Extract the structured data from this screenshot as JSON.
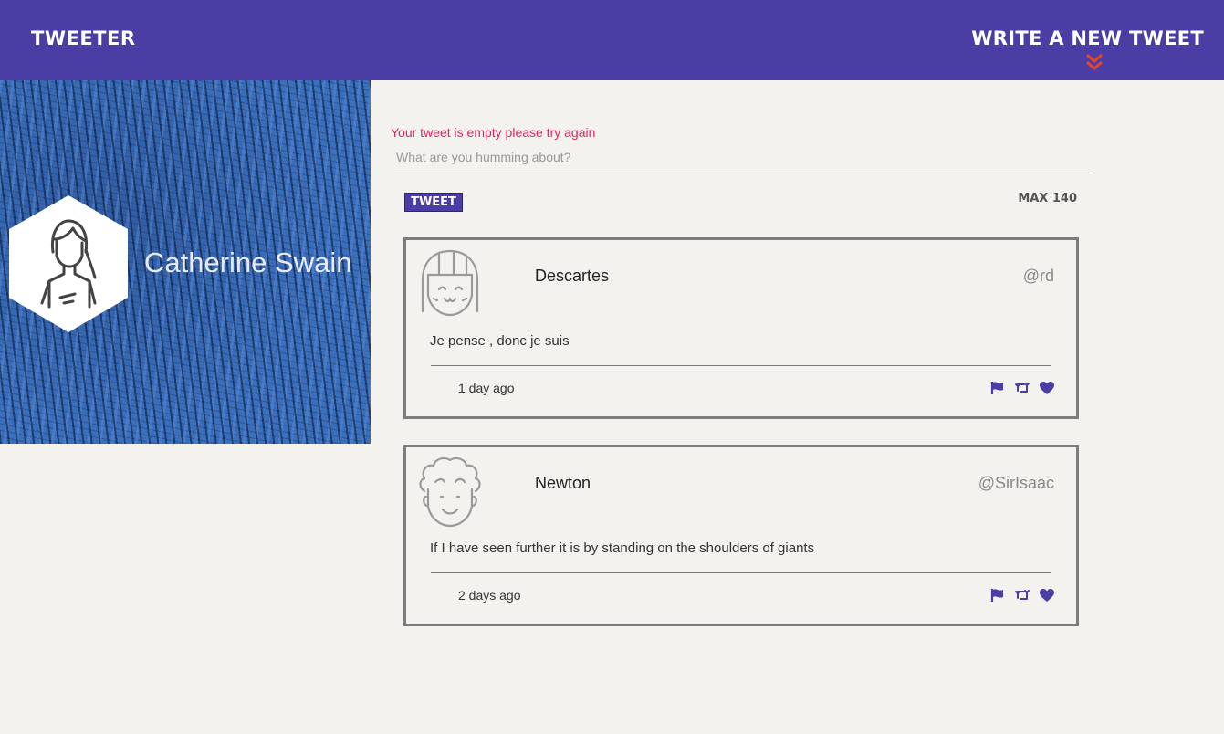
{
  "nav": {
    "brand": "Tweeter",
    "compose_label": "Write a new tweet",
    "chevron_color": "#e8442a",
    "background": "#4a3da3"
  },
  "profile": {
    "name": "Catherine Swain",
    "avatar_icon": "woman-avatar-icon"
  },
  "compose": {
    "error": "Your tweet is empty please try again",
    "placeholder": "What are you humming about?",
    "submit_label": "Tweet",
    "counter": "MAX 140"
  },
  "tweets": [
    {
      "author": "Descartes",
      "handle": "@rd",
      "content": "Je pense , donc je suis",
      "time": "1 day ago",
      "avatar_icon": "girl-face-avatar-icon"
    },
    {
      "author": "Newton",
      "handle": "@SirIsaac",
      "content": "If I have seen further it is by standing on the shoulders of giants",
      "time": "2 days ago",
      "avatar_icon": "curly-hair-avatar-icon"
    }
  ],
  "colors": {
    "accent": "#4a3da3",
    "error": "#e0245e",
    "page_bg": "#f4f2ee",
    "tweet_border": "#7d7d7d"
  }
}
